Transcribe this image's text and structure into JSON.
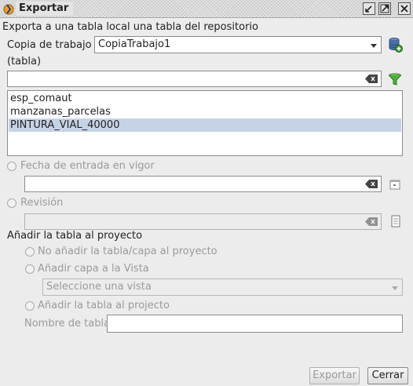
{
  "window": {
    "title": "Exportar",
    "buttons": [
      "minimize",
      "maximize",
      "close"
    ]
  },
  "description": "Exporta a una tabla local una tabla del repositorio",
  "working_copy": {
    "label": "Copia de trabajo",
    "value": "CopiaTrabajo1"
  },
  "table_section": {
    "label": "(tabla)",
    "filter_value": "",
    "items": [
      "esp_comaut",
      "manzanas_parcelas",
      "PINTURA_VIAL_40000"
    ],
    "selected_index": 2
  },
  "date_option": {
    "label": "Fecha de entrada en vigor",
    "value": "",
    "enabled": false
  },
  "revision_option": {
    "label": "Revisión",
    "value": "",
    "enabled": false
  },
  "add_to_project": {
    "label": "Añadir la tabla al proyecto",
    "options": [
      "No añadir la tabla/capa al proyecto",
      "Añadir capa a la Vista",
      "Añadir la tabla al projecto"
    ],
    "view_placeholder": "Seleccione una vista",
    "table_name_label": "Nombre de tabla",
    "table_name_value": ""
  },
  "buttons": {
    "export": "Exportar",
    "close": "Cerrar"
  },
  "colors": {
    "selection": "#c6d3e6",
    "filter_icon": "#3a9a2a",
    "db_icon": "#4a6fa5"
  }
}
